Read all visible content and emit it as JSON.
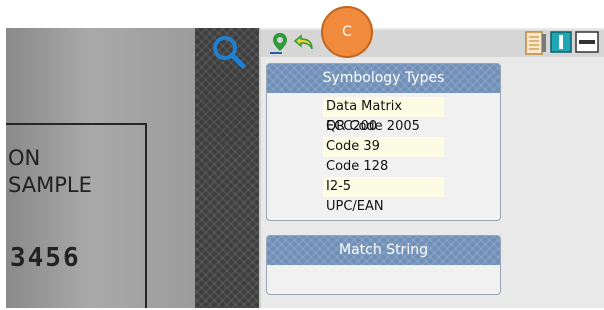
{
  "camera": {
    "line1": "ON",
    "line2": "SAMPLE",
    "number": "3456"
  },
  "toolbar": {
    "badge_label": "C"
  },
  "symbology": {
    "title": "Symbology Types",
    "items": [
      "Data Matrix ECC200",
      "QR Code 2005",
      "Code 39",
      "Code 128",
      "I2-5",
      "UPC/EAN"
    ]
  },
  "match": {
    "title": "Match String"
  },
  "colors": {
    "card_header": "#6f8fb8",
    "badge": "#f08a3c",
    "search_icon": "#1f7fd0",
    "highlight_row": "#fcfbe3"
  },
  "icons": [
    "search-icon",
    "pin-icon",
    "undo-icon",
    "notes-icon",
    "view-toggle-icon",
    "minimize-icon"
  ]
}
